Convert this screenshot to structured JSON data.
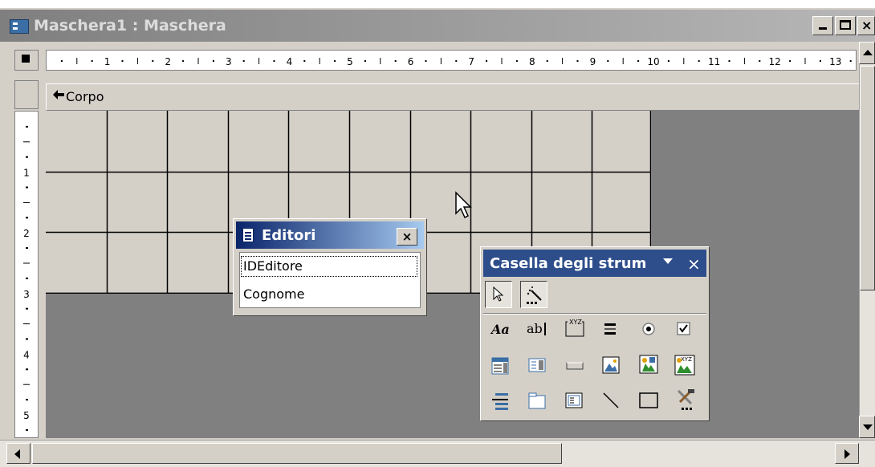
{
  "window": {
    "title": "Maschera1 : Maschera",
    "min_label": "_",
    "max_label": "□",
    "close_label": "×"
  },
  "ruler": {
    "top_numbers": [
      "1",
      "2",
      "3",
      "4",
      "5",
      "6",
      "7",
      "8",
      "9",
      "10",
      "11",
      "12",
      "13"
    ],
    "left_numbers": [
      "1",
      "2",
      "3",
      "4",
      "5"
    ]
  },
  "section": {
    "label": "Corpo",
    "arrow": "◆"
  },
  "field_list": {
    "title": "Editori",
    "close_label": "×",
    "fields": [
      "IDEditore",
      "Cognome"
    ]
  },
  "toolbox": {
    "title": "Casella degli strum",
    "dropdown": "▼",
    "close_label": "×",
    "tools": [
      "select-objects",
      "control-wizards",
      "label",
      "text-box",
      "option-group",
      "toggle-button",
      "option-button",
      "check-box",
      "combo-box",
      "list-box",
      "command-button",
      "image",
      "unbound-object-frame",
      "bound-object-frame",
      "page-break",
      "tab-control",
      "subform",
      "line",
      "rectangle",
      "more-controls"
    ]
  }
}
